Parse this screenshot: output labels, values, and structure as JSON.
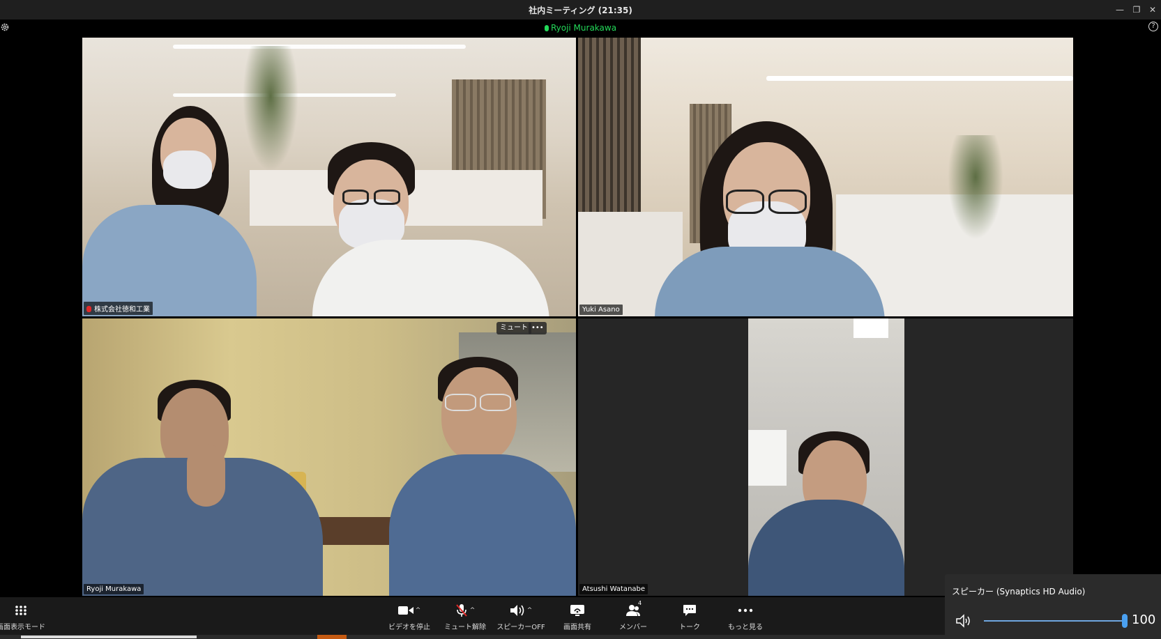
{
  "window": {
    "title": "社内ミーティング (21:35)",
    "minimize_symbol": "—",
    "restore_symbol": "❐",
    "close_symbol": "✕"
  },
  "active_speaker": {
    "name": "Ryoji Murakawa"
  },
  "help_symbol": "?",
  "tiles": {
    "top_left": {
      "name": "株式会社徳和工業",
      "muted": true
    },
    "top_right": {
      "name": "Yuki Asano"
    },
    "bottom_left": {
      "name": "Ryoji Murakawa",
      "mute_button": "ミュート",
      "more_button": "•••",
      "active": true
    },
    "bottom_right": {
      "name": "Atsushi Watanabe"
    }
  },
  "toolbar": {
    "view_mode": "画面表示モード",
    "stop_video": "ビデオを停止",
    "unmute": "ミュート解除",
    "speaker_off": "スピーカーOFF",
    "share_screen": "画面共有",
    "members": "メンバー",
    "members_count": "4",
    "chat": "トーク",
    "more": "もっと見る"
  },
  "volume_panel": {
    "title": "スピーカー (Synaptics HD Audio)",
    "value": "100"
  },
  "colors": {
    "active_speaker": "#23d959",
    "muted": "#e02828",
    "slider": "#4aa0f0"
  },
  "icons": [
    "gear-icon",
    "help-icon",
    "grid-icon",
    "camera-icon",
    "mic-off-icon",
    "speaker-icon",
    "share-screen-icon",
    "members-icon",
    "chat-icon",
    "more-icon",
    "volume-icon"
  ]
}
